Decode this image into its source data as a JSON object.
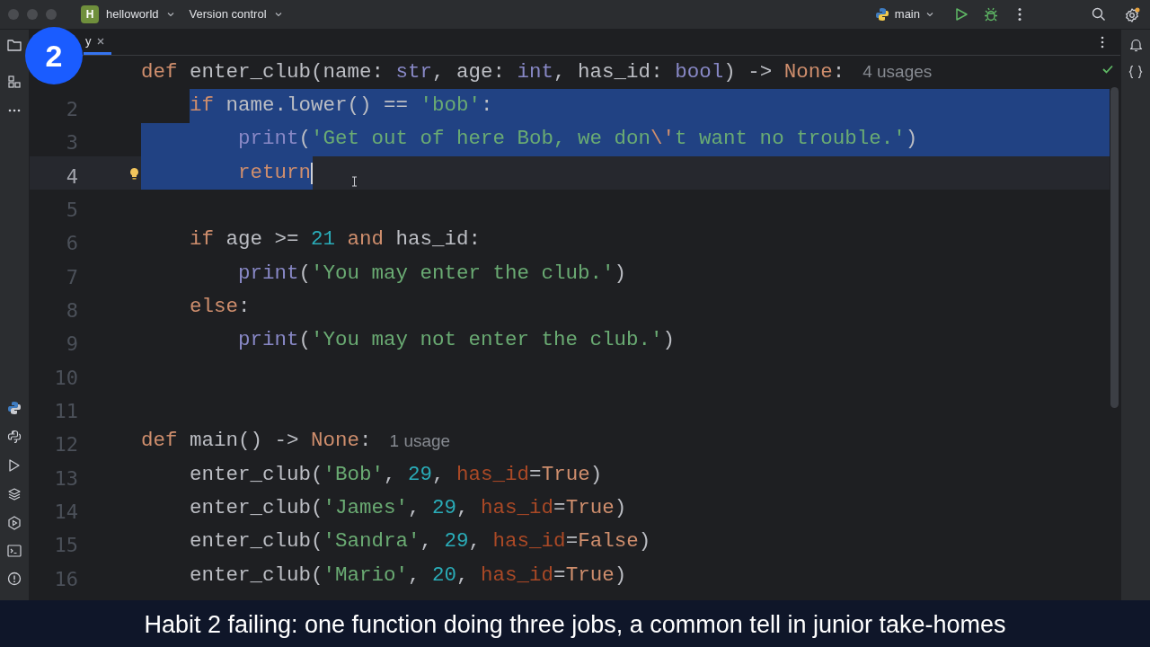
{
  "title_bar": {
    "project_initial": "H",
    "project": "helloworld",
    "vcs": "Version control",
    "run_config": "main"
  },
  "badge": "2",
  "tabs": [
    {
      "label": "y",
      "selected": true
    }
  ],
  "editor": {
    "lines": [
      {
        "kind": "top",
        "selected": false,
        "current": false,
        "bulb": false,
        "caret": false,
        "tokens": [
          {
            "kind": "kw",
            "t": "def"
          },
          {
            "kind": "plain",
            "t": " enter_club(name: "
          },
          {
            "kind": "type",
            "t": "str"
          },
          {
            "kind": "plain",
            "t": ", age: "
          },
          {
            "kind": "type",
            "t": "int"
          },
          {
            "kind": "plain",
            "t": ", has_id: "
          },
          {
            "kind": "type",
            "t": "bool"
          },
          {
            "kind": "plain",
            "t": ") -> "
          },
          {
            "kind": "kw",
            "t": "None"
          },
          {
            "kind": "plain",
            "t": ":"
          }
        ],
        "hint": "4 usages"
      },
      {
        "number": "2",
        "kind": "body",
        "selected": true,
        "current": false,
        "bulb": false,
        "caret": false,
        "tokens": [
          {
            "kind": "kw",
            "t": "if"
          },
          {
            "kind": "plain",
            "t": " name.lower() == "
          },
          {
            "kind": "str",
            "t": "'bob'"
          },
          {
            "kind": "plain",
            "t": ":"
          }
        ]
      },
      {
        "number": "3",
        "kind": "nested",
        "selected": true,
        "current": false,
        "bulb": false,
        "caret": false,
        "tokens": [
          {
            "kind": "builtin",
            "t": "print"
          },
          {
            "kind": "plain",
            "t": "("
          },
          {
            "kind": "str",
            "t": "'Get out of here Bob, we don"
          },
          {
            "kind": "kw",
            "t": "\\'"
          },
          {
            "kind": "str",
            "t": "t want no trouble.'"
          },
          {
            "kind": "plain",
            "t": ")"
          }
        ]
      },
      {
        "number": "4",
        "kind": "nested",
        "selected": true,
        "current": true,
        "bulb": true,
        "caret": true,
        "tokens": [
          {
            "kind": "kw",
            "t": "return"
          }
        ]
      },
      {
        "number": "5",
        "kind": "top",
        "selected": false,
        "current": false,
        "bulb": false,
        "caret": false
      },
      {
        "number": "6",
        "kind": "body",
        "selected": false,
        "current": false,
        "bulb": false,
        "caret": false,
        "tokens": [
          {
            "kind": "kw",
            "t": "if"
          },
          {
            "kind": "plain",
            "t": " age >= "
          },
          {
            "kind": "num",
            "t": "21"
          },
          {
            "kind": "kw",
            "t": " and"
          },
          {
            "kind": "plain",
            "t": " has_id:"
          }
        ]
      },
      {
        "number": "7",
        "kind": "nested",
        "selected": false,
        "current": false,
        "bulb": false,
        "caret": false,
        "tokens": [
          {
            "kind": "builtin",
            "t": "print"
          },
          {
            "kind": "plain",
            "t": "("
          },
          {
            "kind": "str",
            "t": "'You may enter the club.'"
          },
          {
            "kind": "plain",
            "t": ")"
          }
        ]
      },
      {
        "number": "8",
        "kind": "body",
        "selected": false,
        "current": false,
        "bulb": false,
        "caret": false,
        "tokens": [
          {
            "kind": "kw",
            "t": "else"
          },
          {
            "kind": "plain",
            "t": ":"
          }
        ]
      },
      {
        "number": "9",
        "kind": "nested",
        "selected": false,
        "current": false,
        "bulb": false,
        "caret": false,
        "tokens": [
          {
            "kind": "builtin",
            "t": "print"
          },
          {
            "kind": "plain",
            "t": "("
          },
          {
            "kind": "str",
            "t": "'You may not enter the club.'"
          },
          {
            "kind": "plain",
            "t": ")"
          }
        ]
      },
      {
        "number": "10",
        "kind": "top",
        "selected": false,
        "current": false,
        "bulb": false,
        "caret": false
      },
      {
        "number": "11",
        "kind": "top",
        "selected": false,
        "current": false,
        "bulb": false,
        "caret": false
      },
      {
        "number": "12",
        "kind": "top",
        "selected": false,
        "current": false,
        "bulb": false,
        "caret": false,
        "tokens": [
          {
            "kind": "kw",
            "t": "def"
          },
          {
            "kind": "plain",
            "t": " main() -> "
          },
          {
            "kind": "kw",
            "t": "None"
          },
          {
            "kind": "plain",
            "t": ":"
          }
        ],
        "hint": "1 usage"
      },
      {
        "number": "13",
        "kind": "body",
        "selected": false,
        "current": false,
        "bulb": false,
        "caret": false,
        "tokens": [
          {
            "kind": "plain",
            "t": "enter_club("
          },
          {
            "kind": "str",
            "t": "'Bob'"
          },
          {
            "kind": "plain",
            "t": ", "
          },
          {
            "kind": "num",
            "t": "29"
          },
          {
            "kind": "plain",
            "t": ", "
          },
          {
            "kind": "param",
            "t": "has_id"
          },
          {
            "kind": "plain",
            "t": "="
          },
          {
            "kind": "kw",
            "t": "True"
          },
          {
            "kind": "plain",
            "t": ")"
          }
        ]
      },
      {
        "number": "14",
        "kind": "body",
        "selected": false,
        "current": false,
        "bulb": false,
        "caret": false,
        "tokens": [
          {
            "kind": "plain",
            "t": "enter_club("
          },
          {
            "kind": "str",
            "t": "'James'"
          },
          {
            "kind": "plain",
            "t": ", "
          },
          {
            "kind": "num",
            "t": "29"
          },
          {
            "kind": "plain",
            "t": ", "
          },
          {
            "kind": "param",
            "t": "has_id"
          },
          {
            "kind": "plain",
            "t": "="
          },
          {
            "kind": "kw",
            "t": "True"
          },
          {
            "kind": "plain",
            "t": ")"
          }
        ]
      },
      {
        "number": "15",
        "kind": "body",
        "selected": false,
        "current": false,
        "bulb": false,
        "caret": false,
        "tokens": [
          {
            "kind": "plain",
            "t": "enter_club("
          },
          {
            "kind": "str",
            "t": "'Sandra'"
          },
          {
            "kind": "plain",
            "t": ", "
          },
          {
            "kind": "num",
            "t": "29"
          },
          {
            "kind": "plain",
            "t": ", "
          },
          {
            "kind": "param",
            "t": "has_id"
          },
          {
            "kind": "plain",
            "t": "="
          },
          {
            "kind": "kw",
            "t": "False"
          },
          {
            "kind": "plain",
            "t": ")"
          }
        ]
      },
      {
        "number": "16",
        "kind": "body",
        "selected": false,
        "current": false,
        "bulb": false,
        "caret": false,
        "tokens": [
          {
            "kind": "plain",
            "t": "enter_club("
          },
          {
            "kind": "str",
            "t": "'Mario'"
          },
          {
            "kind": "plain",
            "t": ", "
          },
          {
            "kind": "num",
            "t": "20"
          },
          {
            "kind": "plain",
            "t": ", "
          },
          {
            "kind": "param",
            "t": "has_id"
          },
          {
            "kind": "plain",
            "t": "="
          },
          {
            "kind": "kw",
            "t": "True"
          },
          {
            "kind": "plain",
            "t": ")"
          }
        ]
      }
    ]
  },
  "caption": "Habit 2 failing: one function doing three jobs, a common tell in junior take-homes"
}
